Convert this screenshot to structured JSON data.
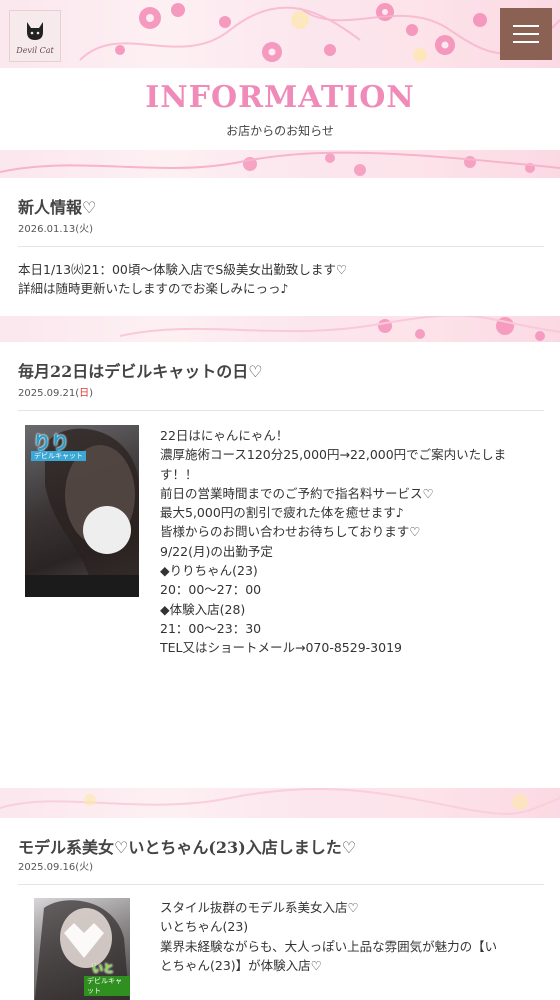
{
  "header": {
    "logo_text": "Devil Cat",
    "menu_label": "menu"
  },
  "page": {
    "title": "INFORMATION",
    "subtitle": "お店からのお知らせ"
  },
  "posts": [
    {
      "title": "新人情報♡",
      "date": "2026.01.13(火)",
      "lines": [
        "本日1/13㈫21：00頃～体験入店でS級美女出勤致します♡",
        "詳細は随時更新いたしますのでお楽しみにっっ♪"
      ]
    },
    {
      "title": "毎月22日はデビルキャットの日♡",
      "date_prefix": "2025.09.21(",
      "date_day": "日",
      "date_suffix": ")",
      "photo_badge": "りり",
      "photo_badge_sub": "デビルキャット",
      "lines": [
        "22日はにゃんにゃん！",
        "濃厚施術コース120分25,000円→22,000円でご案内いたしま",
        "す！！",
        "",
        "前日の営業時間までのご予約で指名料サービス♡",
        "",
        "最大5,000円の割引で疲れた体を癒せます♪",
        "",
        "皆様からのお問い合わせお待ちしております♡",
        "",
        "9/22(月)の出勤予定",
        "◆りりちゃん(23)",
        "20：00～27：00",
        "◆体験入店(28)",
        "21：00～23：30",
        "",
        "TEL又はショートメール→070-8529-3019"
      ]
    },
    {
      "title": "モデル系美女♡いとちゃん(23)入店しました♡",
      "date": "2025.09.16(火)",
      "photo_badge": "いと",
      "photo_badge_sub": "デビルキャット",
      "lines": [
        "スタイル抜群のモデル系美女入店♡",
        "",
        "いとちゃん(23)",
        "",
        "業界未経験ながらも、大人っぽい上品な雰囲気が魅力の【い",
        "とちゃん(23)】が体験入店♡"
      ]
    }
  ],
  "colors": {
    "title_pink": "#f08ab8",
    "menu_brown": "#8a6153",
    "sunday_red": "#e0362b",
    "badge_blue": "#1d9fd0"
  }
}
